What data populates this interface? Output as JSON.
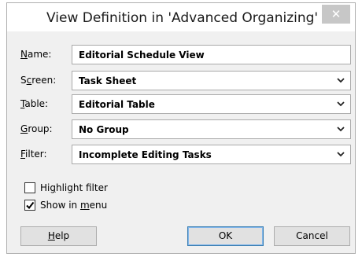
{
  "dialog": {
    "title": "View Definition in 'Advanced Organizing'",
    "close_glyph": "✕"
  },
  "fields": {
    "name": {
      "label_accel": "N",
      "label_rest": "ame:",
      "value": "Editorial Schedule View"
    },
    "screen": {
      "label_pre": "S",
      "label_accel": "c",
      "label_rest": "reen:",
      "value": "Task Sheet"
    },
    "table": {
      "label_accel": "T",
      "label_rest": "able:",
      "value": "Editorial Table"
    },
    "group": {
      "label_accel": "G",
      "label_rest": "roup:",
      "value": "No Group"
    },
    "filter": {
      "label_accel": "F",
      "label_rest": "ilter:",
      "value": "Incomplete Editing Tasks"
    }
  },
  "options": {
    "highlight_filter": {
      "checked": false,
      "label_pre": "Hi",
      "label_accel": "g",
      "label_rest": "hlight filter"
    },
    "show_in_menu": {
      "checked": true,
      "label_pre": "Show in ",
      "label_accel": "m",
      "label_rest": "enu"
    }
  },
  "buttons": {
    "help": {
      "label_accel": "H",
      "label_rest": "elp"
    },
    "ok": "OK",
    "cancel": "Cancel"
  },
  "icons": {
    "close": "close-icon",
    "dropdown": "chevron-down-icon",
    "check": "checkmark-icon"
  }
}
